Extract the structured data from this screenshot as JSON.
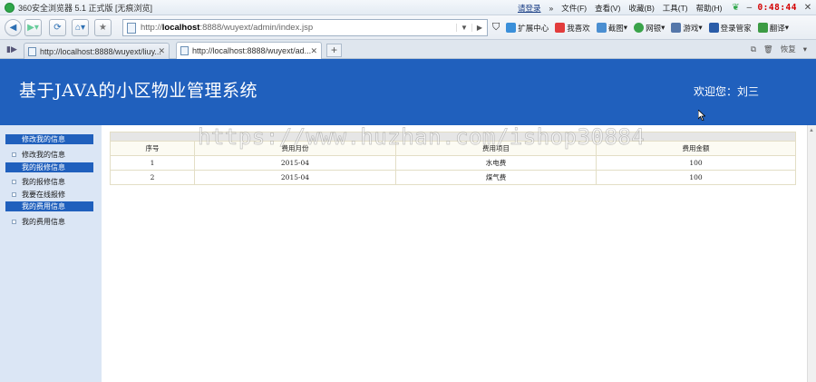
{
  "browser": {
    "title": "360安全浏览器 5.1 正式版 [无痕浏览]",
    "login": "请登录",
    "more": "»",
    "menus": [
      "文件(F)",
      "查看(V)",
      "收藏(B)",
      "工具(T)",
      "帮助(H)"
    ],
    "clock": "0:48:44",
    "url": {
      "prefix": "http://",
      "host": "localhost",
      "rest": ":8888/wuyext/admin/index.jsp"
    },
    "toolbar": [
      "扩展中心",
      "我喜欢",
      "截图",
      "网银",
      "游戏",
      "登录管家",
      "翻译"
    ],
    "tabs": [
      {
        "label": "http://localhost:8888/wuyext/liuy...",
        "active": false
      },
      {
        "label": "http://localhost:8888/wuyext/ad...",
        "active": true
      }
    ],
    "restore_label": "恢复"
  },
  "app": {
    "title": "基于JAVA的小区物业管理系统",
    "welcome": "欢迎您：刘三"
  },
  "sidebar": {
    "sections": [
      {
        "header": "修改我的信息",
        "items": [
          "修改我的信息"
        ]
      },
      {
        "header": "我的报修信息",
        "items": [
          "我的报修信息",
          "我要在线报修"
        ]
      },
      {
        "header": "我的费用信息",
        "items": [
          "我的费用信息"
        ]
      }
    ]
  },
  "table": {
    "columns": [
      "序号",
      "费用月份",
      "费用项目",
      "费用金额"
    ],
    "rows": [
      [
        "1",
        "2015-04",
        "水电费",
        "100"
      ],
      [
        "2",
        "2015-04",
        "煤气费",
        "100"
      ]
    ]
  },
  "watermark": "https://www.huzhan.com/ishop30884",
  "colors": {
    "header_blue": "#2060bd",
    "sidebar_bg": "#dbe6f5"
  }
}
